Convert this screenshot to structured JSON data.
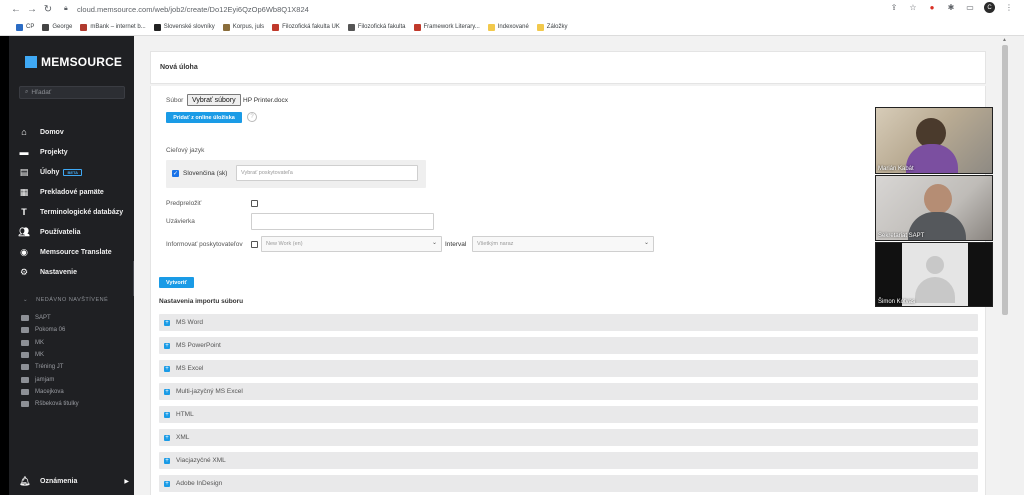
{
  "browser": {
    "url": "cloud.memsource.com/web/job2/create/Do12Eyi6QzOp6Wb8Q1X824",
    "bookmarks": [
      "CP",
      "George",
      "mBank – internet b...",
      "Slovenské slovníky",
      "Korpus, juls",
      "Filozofická fakulta UK",
      "Filozofická fakulta",
      "Framework Literary...",
      "Indexované",
      "Záložky"
    ]
  },
  "sidebar": {
    "logo": "MEMSOURCE",
    "search_placeholder": "Hľadať",
    "nav": [
      {
        "label": "Domov",
        "icon": "home-icon"
      },
      {
        "label": "Projekty",
        "icon": "folder-icon"
      },
      {
        "label": "Úlohy",
        "icon": "document-icon",
        "badge": "BETA"
      },
      {
        "label": "Prekladové pamäte",
        "icon": "memory-icon"
      },
      {
        "label": "Terminologické databázy",
        "icon": "term-icon"
      },
      {
        "label": "Používatelia",
        "icon": "users-icon"
      },
      {
        "label": "Memsource Translate",
        "icon": "translate-icon"
      },
      {
        "label": "Nastavenie",
        "icon": "gear-icon"
      }
    ],
    "recent_heading": "NEDÁVNO NAVŠTÍVENÉ",
    "recent": [
      "SAPT",
      "Pokoma 06",
      "MK",
      "MK",
      "Tréning JT",
      "jamjam",
      "Macejkova",
      "Ršbeková titulky"
    ],
    "notifications": "Oznámenia"
  },
  "main": {
    "panel_title": "Nová úloha",
    "file_label": "Súbor",
    "file_button": "Vybrať súbory",
    "file_name": "HP Printer.docx",
    "add_online_button": "Pridať z online úložiska",
    "target_lang_label": "Cieľový jazyk",
    "lang_checked": "Slovenčina (sk)",
    "provider_placeholder": "Vybrať poskytovateľa",
    "pretranslate_label": "Predpreložiť",
    "deadline_label": "Uzávierka",
    "notify_label": "Informovať poskytovateľov",
    "notify_select": "New Work (en)",
    "interval_label": "Interval",
    "interval_select": "Všetkým naraz",
    "create_button": "Vytvoriť",
    "import_section": "Nastavenia importu súboru",
    "import_items": [
      "MS Word",
      "MS PowerPoint",
      "MS Excel",
      "Multi-jazyčný MS Excel",
      "HTML",
      "XML",
      "Viacjazyčné XML",
      "Adobe InDesign"
    ]
  },
  "video": {
    "participants": [
      "Marián Kabát",
      "Sekretariat SAPT",
      "Šimon Kotvas"
    ]
  }
}
